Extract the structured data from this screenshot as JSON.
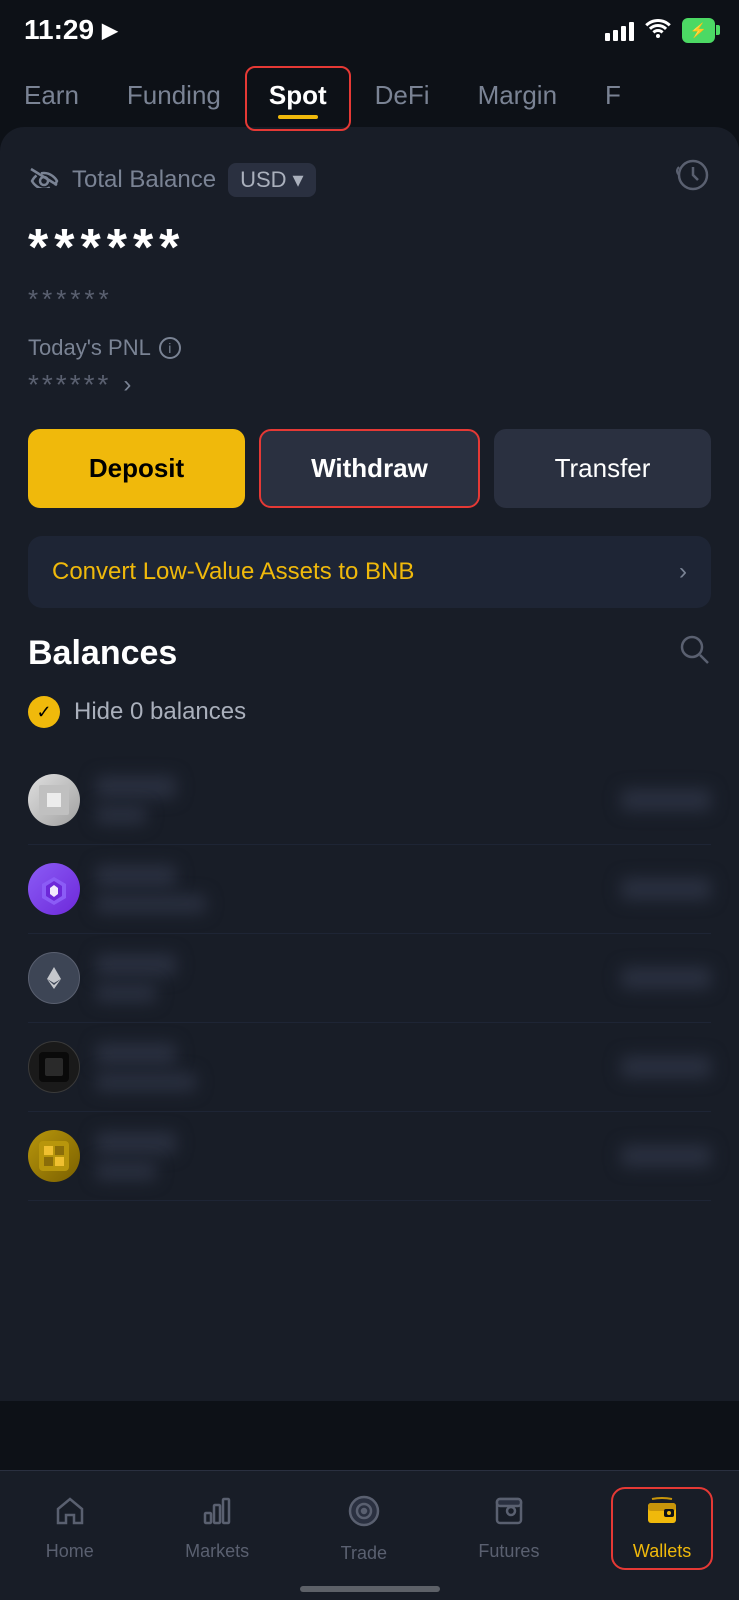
{
  "statusBar": {
    "time": "11:29",
    "locationIcon": "◀",
    "signalBars": [
      6,
      10,
      14,
      18,
      22
    ],
    "batteryLevel": "⚡"
  },
  "tabs": [
    {
      "id": "earn",
      "label": "Earn",
      "active": false,
      "highlighted": false
    },
    {
      "id": "funding",
      "label": "Funding",
      "active": false,
      "highlighted": false
    },
    {
      "id": "spot",
      "label": "Spot",
      "active": true,
      "highlighted": true
    },
    {
      "id": "defi",
      "label": "DeFi",
      "active": false,
      "highlighted": false
    },
    {
      "id": "margin",
      "label": "Margin",
      "active": false,
      "highlighted": false
    },
    {
      "id": "f",
      "label": "F",
      "active": false,
      "highlighted": false
    }
  ],
  "balance": {
    "eyeSlashIcon": "👁",
    "label": "Total Balance",
    "currency": "USD",
    "currencyDropIcon": "▾",
    "historyIcon": "🕐",
    "stars": "******",
    "subStars": "******",
    "pnlLabel": "Today's PNL",
    "pnlInfoIcon": "i",
    "pnlStars": "******",
    "pnlArrow": "›"
  },
  "actions": {
    "depositLabel": "Deposit",
    "withdrawLabel": "Withdraw",
    "transferLabel": "Transfer"
  },
  "convertBanner": {
    "text": "Convert Low-Value Assets to BNB",
    "arrow": "›"
  },
  "balancesSection": {
    "title": "Balances",
    "searchIcon": "🔍",
    "hideZeroLabel": "Hide 0 balances",
    "checkIcon": "✓",
    "coins": [
      {
        "id": "btc",
        "iconType": "btc",
        "iconText": "₿",
        "nameBlurred": true,
        "subtitleBlurred": true,
        "amountBlurred": true
      },
      {
        "id": "bnb",
        "iconType": "bnb",
        "iconText": "◈",
        "nameBlurred": true,
        "subtitleBlurred": true,
        "amountBlurred": true
      },
      {
        "id": "eth",
        "iconType": "eth",
        "iconText": "Ξ",
        "nameBlurred": true,
        "subtitleBlurred": true,
        "amountBlurred": true
      },
      {
        "id": "usdt",
        "iconType": "usdt",
        "iconText": "₮",
        "nameBlurred": true,
        "subtitleBlurred": true,
        "amountBlurred": true
      },
      {
        "id": "other",
        "iconType": "other",
        "iconText": "◆",
        "nameBlurred": true,
        "subtitleBlurred": true,
        "amountBlurred": true
      }
    ]
  },
  "bottomNav": {
    "items": [
      {
        "id": "home",
        "icon": "⌂",
        "label": "Home",
        "active": false,
        "highlighted": false
      },
      {
        "id": "markets",
        "icon": "📊",
        "label": "Markets",
        "active": false,
        "highlighted": false
      },
      {
        "id": "trade",
        "icon": "◎",
        "label": "Trade",
        "active": false,
        "highlighted": false
      },
      {
        "id": "futures",
        "icon": "📋",
        "label": "Futures",
        "active": false,
        "highlighted": false
      },
      {
        "id": "wallets",
        "icon": "💼",
        "label": "Wallets",
        "active": true,
        "highlighted": true
      }
    ]
  }
}
